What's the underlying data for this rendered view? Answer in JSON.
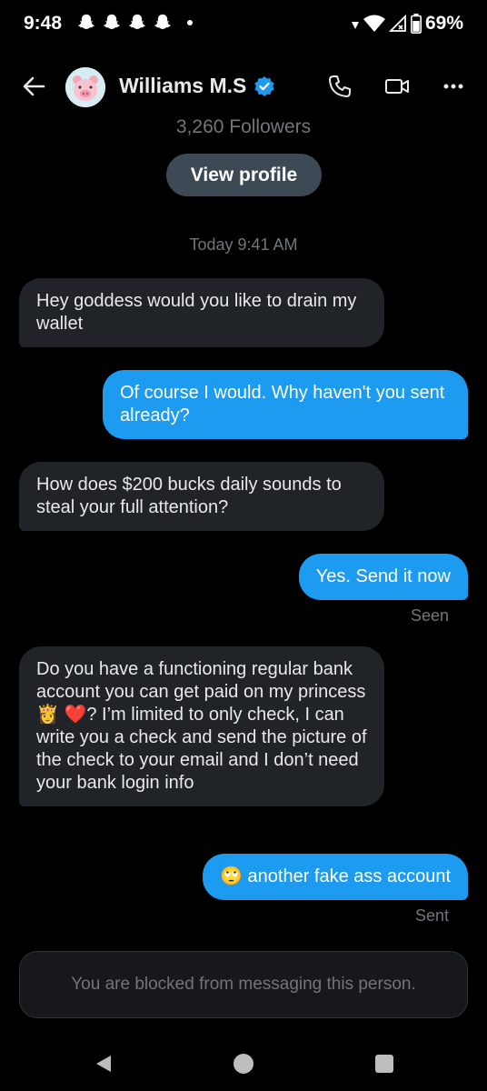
{
  "status_bar": {
    "time": "9:48",
    "battery": "69%"
  },
  "header": {
    "name": "Williams M.S"
  },
  "profile": {
    "followers": "3,260 Followers",
    "view_profile": "View profile"
  },
  "conversation": {
    "timestamp": "Today 9:41 AM",
    "messages": [
      {
        "from": "them",
        "text": "Hey goddess would you like to drain my wallet"
      },
      {
        "from": "me",
        "text": "Of course I would. Why haven't you sent already?"
      },
      {
        "from": "them",
        "text": "How does $200 bucks daily sounds to steal your full attention?"
      },
      {
        "from": "me",
        "text": "Yes. Send it now",
        "status": "Seen"
      },
      {
        "from": "them",
        "text": "Do you have a functioning regular bank account you can get paid on my princess 👸 ❤️? I’m limited to only check, I can write you a check and send the picture of the check to your email and I don’t need your bank login info"
      },
      {
        "from": "me",
        "text": "🙄 another fake ass account",
        "status": "Sent"
      }
    ]
  },
  "composer": {
    "blocked_text": "You are blocked from messaging this person."
  },
  "colors": {
    "accent": "#1d9bf0",
    "background": "#000000",
    "received_bubble": "#202327"
  },
  "icons": [
    "snapchat-icon",
    "wifi-icon",
    "signal-icon",
    "battery-icon",
    "back-arrow-icon",
    "verified-badge-icon",
    "phone-icon",
    "video-icon",
    "more-icon",
    "nav-back-icon",
    "nav-home-icon",
    "nav-recents-icon"
  ]
}
